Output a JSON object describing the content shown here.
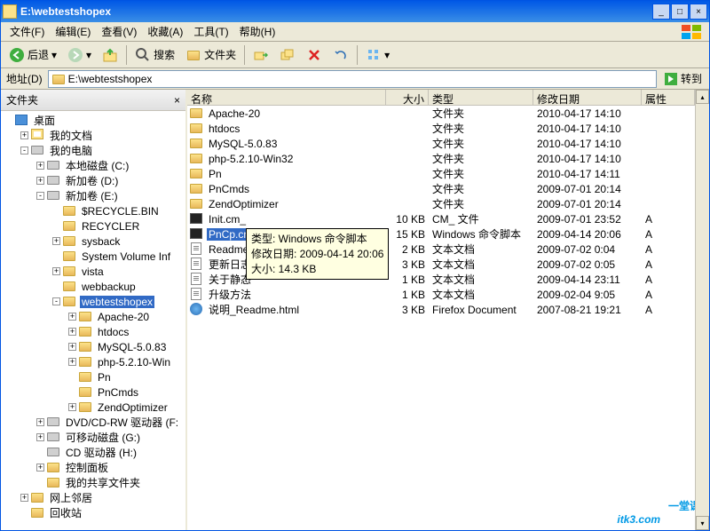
{
  "title": "E:\\webtestshopex",
  "menus": [
    "文件(F)",
    "编辑(E)",
    "查看(V)",
    "收藏(A)",
    "工具(T)",
    "帮助(H)"
  ],
  "toolbar": {
    "back": "后退",
    "search": "搜索",
    "folders": "文件夹"
  },
  "addr": {
    "label": "地址(D)",
    "value": "E:\\webtestshopex",
    "go": "转到"
  },
  "sidebar": {
    "title": "文件夹"
  },
  "tree": [
    {
      "l": 0,
      "e": "",
      "i": "desk",
      "t": "桌面"
    },
    {
      "l": 1,
      "e": "+",
      "i": "mydoc",
      "t": "我的文档"
    },
    {
      "l": 1,
      "e": "-",
      "i": "drive",
      "t": "我的电脑"
    },
    {
      "l": 2,
      "e": "+",
      "i": "drive",
      "t": "本地磁盘 (C:)"
    },
    {
      "l": 2,
      "e": "+",
      "i": "drive",
      "t": "新加卷 (D:)"
    },
    {
      "l": 2,
      "e": "-",
      "i": "drive",
      "t": "新加卷 (E:)"
    },
    {
      "l": 3,
      "e": "",
      "i": "folder",
      "t": "$RECYCLE.BIN"
    },
    {
      "l": 3,
      "e": "",
      "i": "folder",
      "t": "RECYCLER"
    },
    {
      "l": 3,
      "e": "+",
      "i": "folder",
      "t": "sysback"
    },
    {
      "l": 3,
      "e": "",
      "i": "folder",
      "t": "System Volume Inf"
    },
    {
      "l": 3,
      "e": "+",
      "i": "folder",
      "t": "vista"
    },
    {
      "l": 3,
      "e": "",
      "i": "folder",
      "t": "webbackup"
    },
    {
      "l": 3,
      "e": "-",
      "i": "folder",
      "t": "webtestshopex",
      "sel": true
    },
    {
      "l": 4,
      "e": "+",
      "i": "folder",
      "t": "Apache-20"
    },
    {
      "l": 4,
      "e": "+",
      "i": "folder",
      "t": "htdocs"
    },
    {
      "l": 4,
      "e": "+",
      "i": "folder",
      "t": "MySQL-5.0.83"
    },
    {
      "l": 4,
      "e": "+",
      "i": "folder",
      "t": "php-5.2.10-Win"
    },
    {
      "l": 4,
      "e": "",
      "i": "folder",
      "t": "Pn"
    },
    {
      "l": 4,
      "e": "",
      "i": "folder",
      "t": "PnCmds"
    },
    {
      "l": 4,
      "e": "+",
      "i": "folder",
      "t": "ZendOptimizer"
    },
    {
      "l": 2,
      "e": "+",
      "i": "drive",
      "t": "DVD/CD-RW 驱动器 (F:"
    },
    {
      "l": 2,
      "e": "+",
      "i": "drive",
      "t": "可移动磁盘 (G:)"
    },
    {
      "l": 2,
      "e": "",
      "i": "drive",
      "t": "CD 驱动器 (H:)"
    },
    {
      "l": 2,
      "e": "+",
      "i": "folder",
      "t": "控制面板"
    },
    {
      "l": 2,
      "e": "",
      "i": "folder",
      "t": "我的共享文件夹"
    },
    {
      "l": 1,
      "e": "+",
      "i": "folder",
      "t": "网上邻居"
    },
    {
      "l": 1,
      "e": "",
      "i": "folder",
      "t": "回收站"
    }
  ],
  "cols": {
    "name": "名称",
    "size": "大小",
    "type": "类型",
    "date": "修改日期",
    "attr": "属性"
  },
  "colw": {
    "name": 224,
    "size": 48,
    "type": 118,
    "date": 122,
    "attr": 60
  },
  "files": [
    {
      "i": "folder",
      "n": "Apache-20",
      "s": "",
      "ty": "文件夹",
      "d": "2010-04-17 14:10",
      "a": ""
    },
    {
      "i": "folder",
      "n": "htdocs",
      "s": "",
      "ty": "文件夹",
      "d": "2010-04-17 14:10",
      "a": ""
    },
    {
      "i": "folder",
      "n": "MySQL-5.0.83",
      "s": "",
      "ty": "文件夹",
      "d": "2010-04-17 14:10",
      "a": ""
    },
    {
      "i": "folder",
      "n": "php-5.2.10-Win32",
      "s": "",
      "ty": "文件夹",
      "d": "2010-04-17 14:10",
      "a": ""
    },
    {
      "i": "folder",
      "n": "Pn",
      "s": "",
      "ty": "文件夹",
      "d": "2010-04-17 14:11",
      "a": ""
    },
    {
      "i": "folder",
      "n": "PnCmds",
      "s": "",
      "ty": "文件夹",
      "d": "2009-07-01 20:14",
      "a": ""
    },
    {
      "i": "folder",
      "n": "ZendOptimizer",
      "s": "",
      "ty": "文件夹",
      "d": "2009-07-01 20:14",
      "a": ""
    },
    {
      "i": "cmd",
      "n": "Init.cm_",
      "s": "10 KB",
      "ty": "CM_ 文件",
      "d": "2009-07-01 23:52",
      "a": "A"
    },
    {
      "i": "cmd",
      "n": "PnCp.cmd",
      "s": "15 KB",
      "ty": "Windows 命令脚本",
      "d": "2009-04-14 20:06",
      "a": "A",
      "sel": true
    },
    {
      "i": "txt",
      "n": "Readme.txt",
      "s": "2 KB",
      "ty": "文本文档",
      "d": "2009-07-02 0:04",
      "a": "A"
    },
    {
      "i": "txt",
      "n": "更新日志",
      "s": "3 KB",
      "ty": "文本文档",
      "d": "2009-07-02 0:05",
      "a": "A"
    },
    {
      "i": "txt",
      "n": "关于静态",
      "s": "1 KB",
      "ty": "文本文档",
      "d": "2009-04-14 23:11",
      "a": "A"
    },
    {
      "i": "txt",
      "n": "升级方法",
      "s": "1 KB",
      "ty": "文本文档",
      "d": "2009-02-04 9:05",
      "a": "A"
    },
    {
      "i": "html",
      "n": "说明_Readme.html",
      "s": "3 KB",
      "ty": "Firefox Document",
      "d": "2007-08-21 19:21",
      "a": "A"
    }
  ],
  "tooltip": {
    "l1": "类型: Windows 命令脚本",
    "l2": "修改日期: 2009-04-14 20:06",
    "l3": "大小: 14.3 KB"
  },
  "watermark": {
    "main": "itk3",
    "dot": ".com",
    "cn": "一堂课"
  }
}
